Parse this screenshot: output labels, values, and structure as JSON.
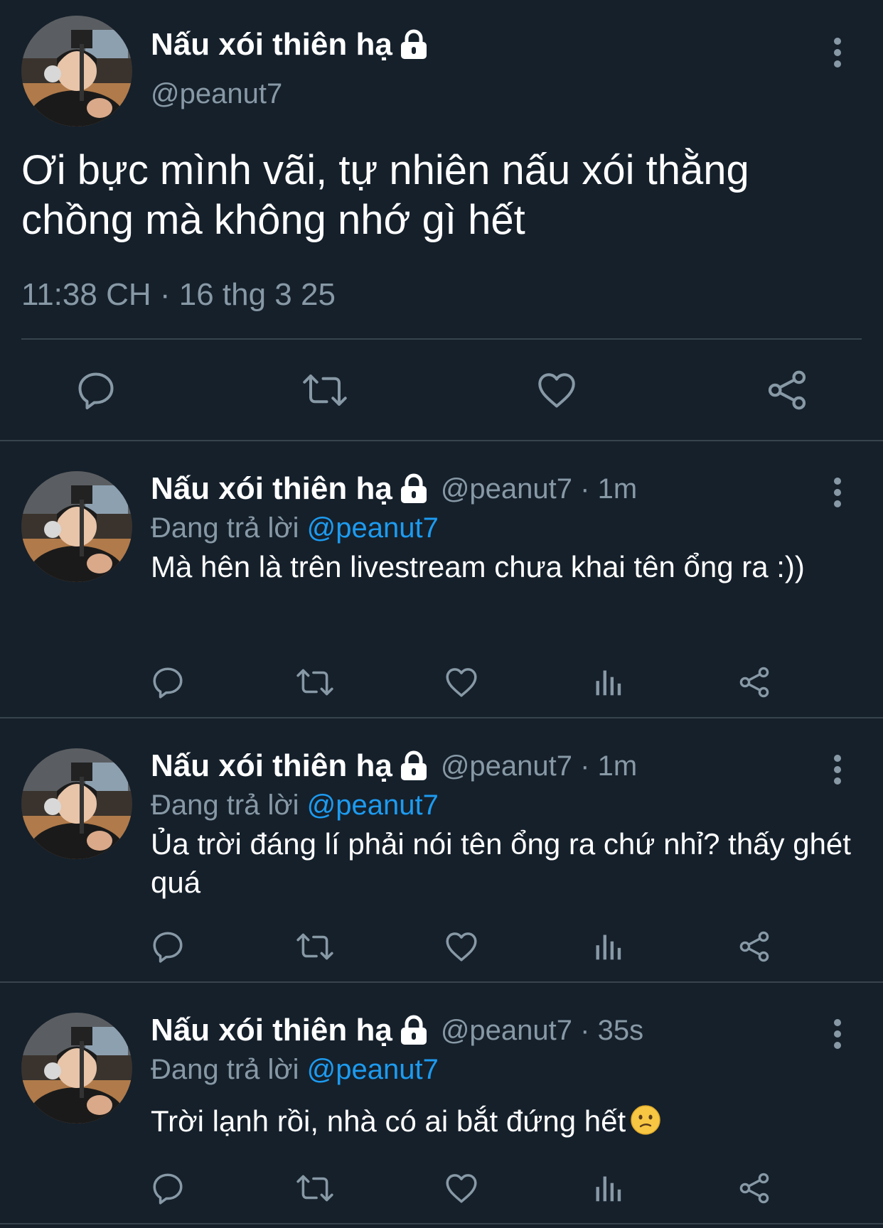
{
  "main_tweet": {
    "display_name": "Nấu xói thiên hạ",
    "handle": "@peanut7",
    "text": "Ơi bực mình vãi, tự nhiên nấu xói thằng chồng mà không nhớ gì hết",
    "timestamp": "11:38 CH · 16 thg 3 25",
    "actions": [
      "reply-icon",
      "retweet-icon",
      "like-icon",
      "share-icon"
    ]
  },
  "replies": [
    {
      "display_name": "Nấu xói thiên hạ",
      "handle_time": "@peanut7 · 1m",
      "replying_label": "Đang trả lời",
      "replying_to": "@peanut7",
      "text": "Mà hên là trên livestream chưa khai tên ổng ra :))"
    },
    {
      "display_name": "Nấu xói thiên hạ",
      "handle_time": "@peanut7 · 1m",
      "replying_label": "Đang trả lời",
      "replying_to": "@peanut7",
      "text": "Ủa trời đáng lí phải nói tên ổng ra chứ nhỉ? thấy ghét quá"
    },
    {
      "display_name": "Nấu xói thiên hạ",
      "handle_time": "@peanut7 · 35s",
      "replying_label": "Đang trả lời",
      "replying_to": "@peanut7",
      "text": "Trời lạnh rồi, nhà có ai bắt đứng hết",
      "emoji": "confused-face"
    }
  ],
  "colors": {
    "background": "#15202b",
    "divider": "#38444d",
    "secondary_text": "#8899a6",
    "mention": "#1d9bf0",
    "icon": "#8899a6"
  }
}
